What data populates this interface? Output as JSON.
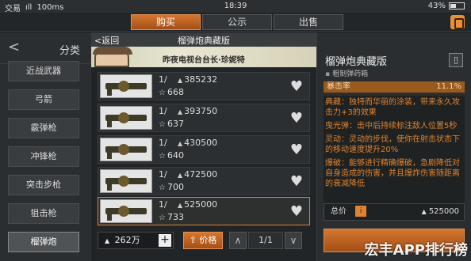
{
  "status_bar": {
    "app": "交易",
    "signal": "ıll",
    "speed": "100ms",
    "time": "18:39",
    "battery": "43%"
  },
  "tabs": {
    "buy": "购买",
    "notice": "公示",
    "sell": "出售",
    "active": "buy"
  },
  "sidebar": {
    "back": "<",
    "title": "分类",
    "items": [
      {
        "label": "近战武器"
      },
      {
        "label": "弓箭"
      },
      {
        "label": "霰弹枪"
      },
      {
        "label": "冲锋枪"
      },
      {
        "label": "突击步枪"
      },
      {
        "label": "狙击枪"
      },
      {
        "label": "榴弹炮",
        "active": true
      }
    ]
  },
  "listing": {
    "back": "<返回",
    "title": "榴弹炮典藏版",
    "banner_text": "昨夜电视台台长·珍妮特",
    "rows": [
      {
        "qty": "1/",
        "price": "385232",
        "stars": "668"
      },
      {
        "qty": "1/",
        "price": "393750",
        "stars": "637"
      },
      {
        "qty": "1/",
        "price": "430500",
        "stars": "640"
      },
      {
        "qty": "1/",
        "price": "472500",
        "stars": "700"
      },
      {
        "qty": "1/",
        "price": "525000",
        "stars": "733",
        "selected": true
      }
    ],
    "coins": "262万",
    "plus": "+",
    "sort_label": "价格",
    "page": "1/1",
    "prev": "∧",
    "next": "∨"
  },
  "detail": {
    "title": "榴弹炮典藏版",
    "subtitle": "粗制弹药箱",
    "stat_label": "暴击率",
    "stat_value": "11.1%",
    "desc": [
      "典藏：独特而华丽的涂装，带来永久攻击力+3的效果",
      "曳光弹：击中后持续标注敌人位置5秒",
      "灵动：灵动的步伐，使你在射击状态下的移动速度提升20%",
      "爆破：能够进行精确爆破，急剧降低对自身造成的伤害，并且爆炸伤害随距离的衰减降低"
    ],
    "total_label": "总价",
    "total_icon": "i",
    "total_price": "525000",
    "watermark": "宏丰APP排行榜"
  },
  "colors": {
    "accent": "#e0822f",
    "background": "#1b1d1f"
  }
}
